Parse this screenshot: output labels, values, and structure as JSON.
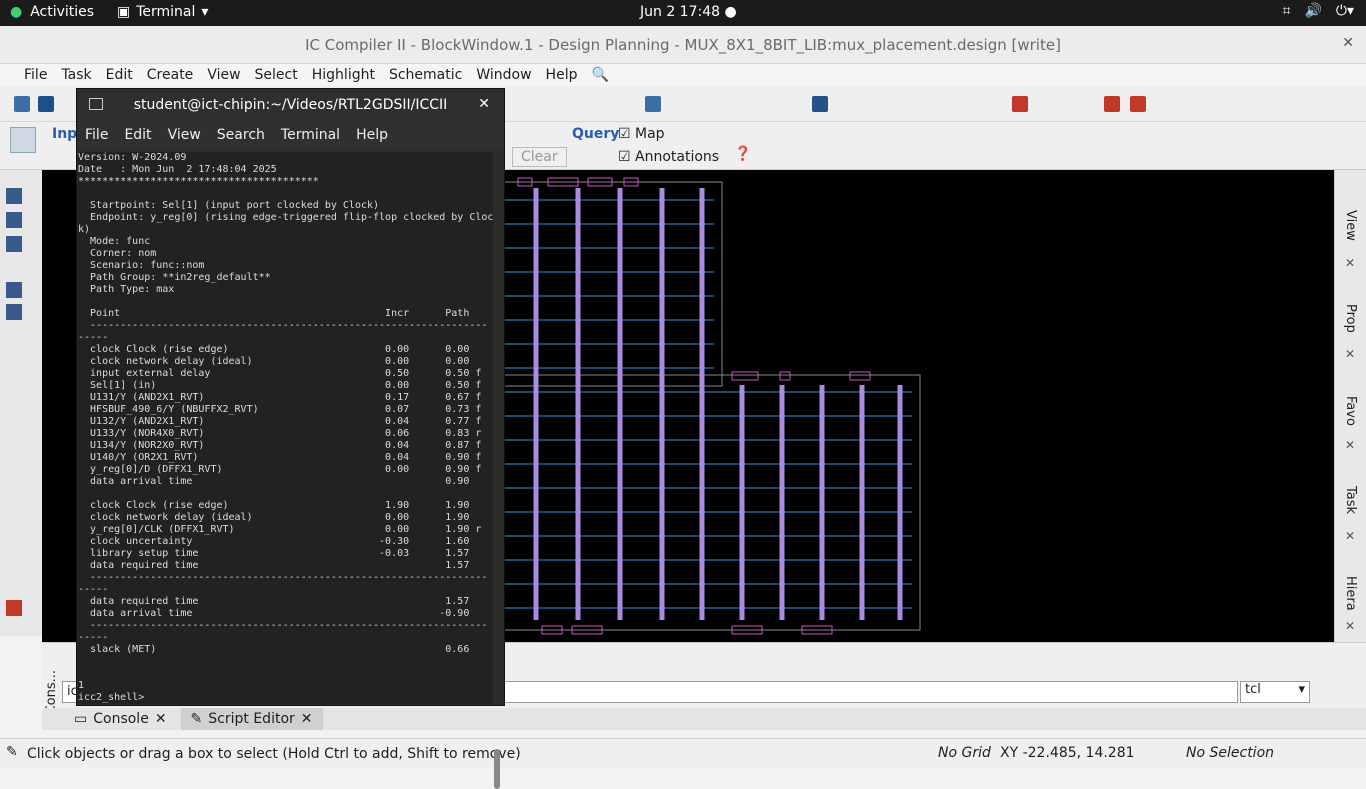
{
  "topbar": {
    "activities": "Activities",
    "app": "Terminal",
    "clock": "Jun 2  17:48 ●"
  },
  "window": {
    "title": "IC Compiler II - BlockWindow.1 - Design Planning - MUX_8X1_8BIT_LIB:mux_placement.design [write]"
  },
  "menu": [
    "File",
    "Task",
    "Edit",
    "Create",
    "View",
    "Select",
    "Highlight",
    "Schematic",
    "Window",
    "Help"
  ],
  "toolbar": {
    "query": "Query",
    "map": "Map",
    "annotations": "Annotations",
    "clear": "Clear",
    "inp": "Inp"
  },
  "terminal": {
    "title": "student@ict-chipin:~/Videos/RTL2GDSII/ICCII",
    "menu": [
      "File",
      "Edit",
      "View",
      "Search",
      "Terminal",
      "Help"
    ],
    "text": "Version: W-2024.09\nDate   : Mon Jun  2 17:48:04 2025\n****************************************\n\n  Startpoint: Sel[1] (input port clocked by Clock)\n  Endpoint: y_reg[0] (rising edge-triggered flip-flop clocked by Cloc\nk)\n  Mode: func\n  Corner: nom\n  Scenario: func::nom\n  Path Group: **in2reg_default**\n  Path Type: max\n\n  Point                                            Incr      Path\n  ------------------------------------------------------------------\n-----\n  clock Clock (rise edge)                          0.00      0.00\n  clock network delay (ideal)                      0.00      0.00\n  input external delay                             0.50      0.50 f\n  Sel[1] (in)                                      0.00      0.50 f\n  U131/Y (AND2X1_RVT)                              0.17      0.67 f\n  HFSBUF_490_6/Y (NBUFFX2_RVT)                     0.07      0.73 f\n  U132/Y (AND2X1_RVT)                              0.04      0.77 f\n  U133/Y (NOR4X0_RVT)                              0.06      0.83 r\n  U134/Y (NOR2X0_RVT)                              0.04      0.87 f\n  U140/Y (OR2X1_RVT)                               0.04      0.90 f\n  y_reg[0]/D (DFFX1_RVT)                           0.00      0.90 f\n  data arrival time                                          0.90\n\n  clock Clock (rise edge)                          1.90      1.90\n  clock network delay (ideal)                      0.00      1.90\n  y_reg[0]/CLK (DFFX1_RVT)                         0.00      1.90 r\n  clock uncertainty                               -0.30      1.60\n  library setup time                              -0.03      1.57\n  data required time                                         1.57\n  ------------------------------------------------------------------\n-----\n  data required time                                         1.57\n  data arrival time                                         -0.90\n  ------------------------------------------------------------------\n-----\n  slack (MET)                                                0.66\n\n\n1\nicc2_shell>"
  },
  "bottom": {
    "console_label": "Cons...",
    "cmd_prefix": "ic",
    "lang": "tcl",
    "tab1": "Console",
    "tab2": "Script Editor"
  },
  "status": {
    "hint": "Click objects or drag a box to select (Hold Ctrl to add, Shift to remove)",
    "grid": "No Grid",
    "xy": "XY -22.485, 14.281",
    "sel": "No Selection"
  },
  "rightdock": [
    "View",
    "Prop",
    "Favo",
    "Task",
    "Hiera"
  ]
}
